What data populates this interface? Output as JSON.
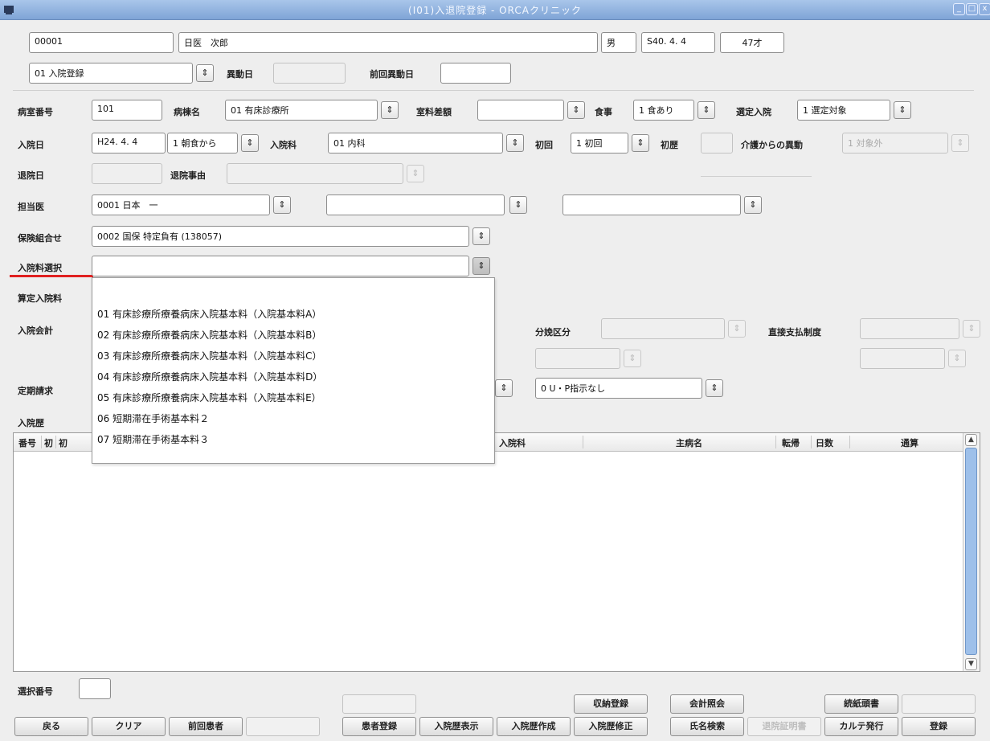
{
  "window": {
    "title": "(I01)入退院登録 - ORCAクリニック",
    "controls": [
      "_",
      "□",
      "x"
    ]
  },
  "patient": {
    "id": "00001",
    "name": "日医　次郎",
    "sex": "男",
    "birthdate": "S40. 4. 4",
    "age": "47才"
  },
  "process": {
    "mode": "01 入院登録",
    "change_date_label": "異動日",
    "change_date": "",
    "prev_change_date_label": "前回異動日",
    "prev_change_date": ""
  },
  "form": {
    "room_label": "病室番号",
    "room": "101",
    "ward_label": "病棟名",
    "ward": "01 有床診療所",
    "room_fee_label": "室料差額",
    "room_fee": "",
    "meal_label": "食事",
    "meal": "1 食あり",
    "selected_adm_label": "選定入院",
    "selected_adm": "1 選定対象",
    "adm_date_label": "入院日",
    "adm_date": "H24. 4. 4",
    "meal_start": "1 朝食から",
    "dept_label": "入院科",
    "dept": "01 内科",
    "first_label": "初回",
    "first": "1 初回",
    "first_hist_label": "初歴",
    "first_hist": "",
    "care_transfer_label": "介護からの異動",
    "care_transfer": "1 対象外",
    "discharge_date_label": "退院日",
    "discharge_date": "",
    "discharge_reason_label": "退院事由",
    "discharge_reason": "",
    "doctor_label": "担当医",
    "doctor1": "0001 日本　一",
    "doctor2": "",
    "doctor3": "",
    "insurance_label": "保険組合せ",
    "insurance": "0002 国保 特定負有 (138057)",
    "fee_select_label": "入院料選択",
    "fee_select": "",
    "calc_fee_label": "算定入院料",
    "accounting_label": "入院会計",
    "delivery_label": "分娩区分",
    "delivery": "",
    "direct_pay_label": "直接支払制度",
    "direct_pay": "",
    "periodic_label": "定期請求",
    "up_instruction": "0 U・P指示なし",
    "history_label": "入院歴"
  },
  "dropdown": {
    "options": [
      "01 有床診療所療養病床入院基本料（入院基本料A）",
      "02 有床診療所療養病床入院基本料（入院基本料B）",
      "03 有床診療所療養病床入院基本料（入院基本料C）",
      "04 有床診療所療養病床入院基本料（入院基本料D）",
      "05 有床診療所療養病床入院基本料（入院基本料E）",
      "06 短期滞在手術基本料２",
      "07 短期滞在手術基本料３"
    ]
  },
  "table": {
    "headers": [
      "番号",
      "初",
      "初",
      "入院科",
      "主病名",
      "転帰",
      "日数",
      "通算"
    ]
  },
  "footer": {
    "select_no_label": "選択番号",
    "select_no": "",
    "row1": [
      "",
      "収納登録",
      "会計照会",
      "続紙頭書",
      ""
    ],
    "row2": [
      "戻る",
      "クリア",
      "前回患者",
      "",
      "患者登録",
      "入院歴表示",
      "入院歴作成",
      "入院歴修正",
      "氏名検索",
      "退院証明書",
      "カルテ発行",
      "登録"
    ]
  },
  "colors": {
    "titlebar": "#8fb0e0",
    "highlight": "#e02020",
    "scroll_thumb": "#9ec0ea"
  }
}
